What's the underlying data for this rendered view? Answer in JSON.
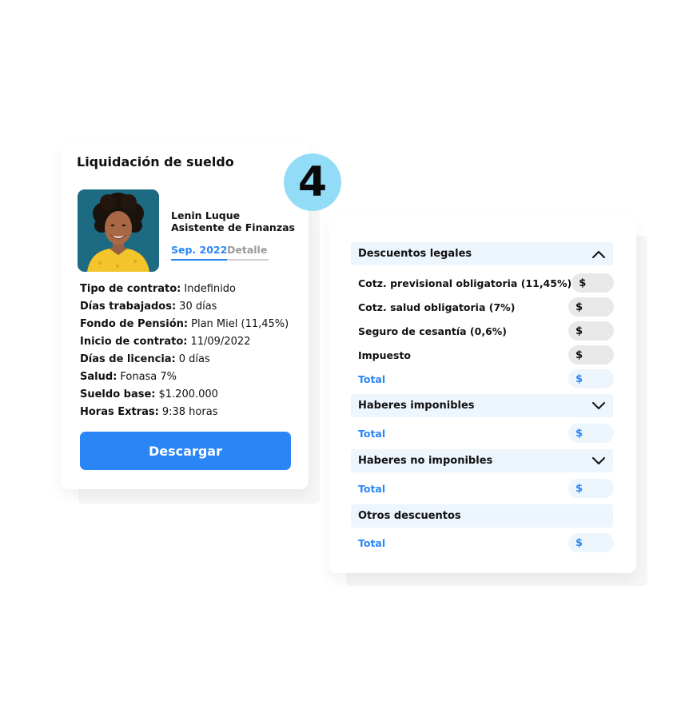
{
  "step": "4",
  "payslip": {
    "title": "Liquidación de sueldo",
    "employee": {
      "name": "Lenin Luque",
      "role": "Asistente de Finanzas"
    },
    "tabs": {
      "period": "Sep. 2022",
      "detail": "Detalle"
    },
    "info": [
      {
        "key": "Tipo de contrato:",
        "value": "Indefinido"
      },
      {
        "key": "Días trabajados:",
        "value": "30 días"
      },
      {
        "key": "Fondo de Pensión:",
        "value": "Plan Miel (11,45%)"
      },
      {
        "key": "Inicio de contrato:",
        "value": "11/09/2022"
      },
      {
        "key": "Días de licencia:",
        "value": "0 días"
      },
      {
        "key": "Salud:",
        "value": "Fonasa 7%"
      },
      {
        "key": "Sueldo base:",
        "value": "$1.200.000"
      },
      {
        "key": "Horas Extras:",
        "value": "9:38 horas"
      }
    ],
    "download_label": "Descargar"
  },
  "breakdown": {
    "currency": "$",
    "total_label": "Total",
    "sections": [
      {
        "title": "Descuentos legales",
        "chevron": "chevron-up-icon",
        "items": [
          "Cotz. previsional obligatoria (11,45%)",
          "Cotz. salud obligatoria (7%)",
          "Seguro de cesantía (0,6%)",
          "Impuesto"
        ]
      },
      {
        "title": "Haberes imponibles",
        "chevron": "chevron-down-icon",
        "items": []
      },
      {
        "title": "Haberes no imponibles",
        "chevron": "chevron-down-icon",
        "items": []
      },
      {
        "title": "Otros descuentos",
        "chevron": "",
        "items": []
      }
    ]
  },
  "colors": {
    "accent": "#2a86f7",
    "badge": "#93dcf8",
    "section_bg": "#edf5fd",
    "amount_bg": "#e8e8e8"
  }
}
